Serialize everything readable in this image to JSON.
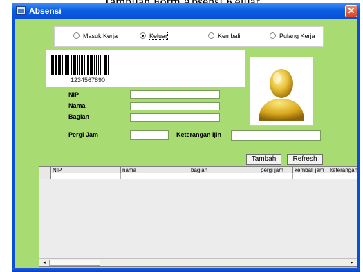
{
  "caption": "Tampilan Form Absensi Keluar",
  "window": {
    "title": "Absensi",
    "close_glyph": "✕"
  },
  "mode_options": [
    {
      "label": "Masuk Kerja",
      "checked": false
    },
    {
      "label": "Keluar",
      "checked": true
    },
    {
      "label": "Kembali",
      "checked": false
    },
    {
      "label": "Pulang Kerja",
      "checked": false
    }
  ],
  "barcode": {
    "number": "1234567890"
  },
  "photo": {
    "icon": "user-avatar-icon"
  },
  "form": {
    "nip_label": "NIP",
    "nip_value": "",
    "nama_label": "Nama",
    "nama_value": "",
    "bagian_label": "Bagian",
    "bagian_value": "",
    "pergi_jam_label": "Pergi Jam",
    "pergi_jam_value": "",
    "keterangan_label": "Keterangan Ijin",
    "keterangan_value": ""
  },
  "buttons": {
    "tambah": "Tambah",
    "refresh": "Refresh"
  },
  "table": {
    "columns": [
      "NIP",
      "nama",
      "bagian",
      "pergi jam",
      "kembali jam",
      "keterangan"
    ],
    "rows": []
  },
  "scrollbar": {
    "left_arrow": "◂",
    "right_arrow": "▸"
  },
  "colors": {
    "titlebar": "#0a4fd8",
    "client_bg": "#a8db72",
    "close": "#d6452a"
  }
}
